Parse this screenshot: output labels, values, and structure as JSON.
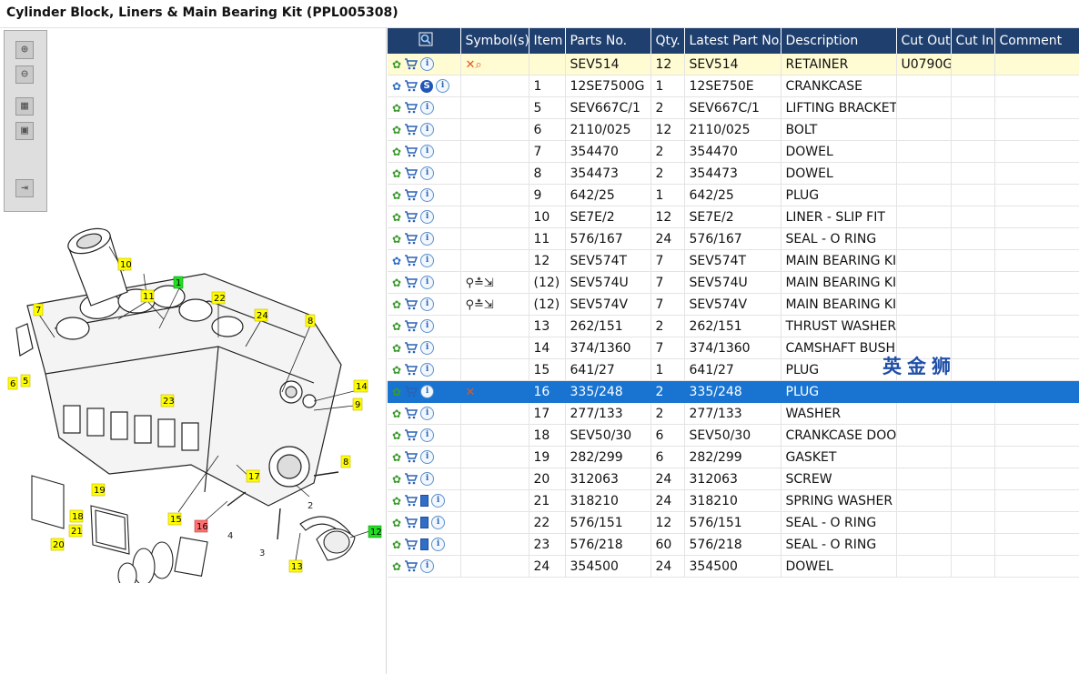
{
  "window": {
    "title": "Cylinder Block, Liners & Main Bearing Kit (PPL005308)"
  },
  "toolbar": {
    "buttons": [
      {
        "icon": "zoom-in-icon",
        "glyph": "⊕"
      },
      {
        "icon": "zoom-out-icon",
        "glyph": "⊖"
      },
      {
        "icon": "fit-page-icon",
        "glyph": "▦"
      },
      {
        "icon": "actual-size-icon",
        "glyph": "▣"
      },
      {
        "icon": "export-icon",
        "glyph": "⇥"
      }
    ]
  },
  "diagram": {
    "callouts": [
      {
        "label": "10",
        "style": "yellow"
      },
      {
        "label": "1",
        "style": "green"
      },
      {
        "label": "11",
        "style": "yellow"
      },
      {
        "label": "22",
        "style": "yellow"
      },
      {
        "label": "7",
        "style": "yellow"
      },
      {
        "label": "24",
        "style": "yellow"
      },
      {
        "label": "8",
        "style": "yellow"
      },
      {
        "label": "6",
        "style": "yellow"
      },
      {
        "label": "5",
        "style": "yellow"
      },
      {
        "label": "14",
        "style": "yellow"
      },
      {
        "label": "9",
        "style": "yellow"
      },
      {
        "label": "23",
        "style": "yellow"
      },
      {
        "label": "8",
        "style": "yellow"
      },
      {
        "label": "17",
        "style": "yellow"
      },
      {
        "label": "19",
        "style": "yellow"
      },
      {
        "label": "15",
        "style": "yellow"
      },
      {
        "label": "18",
        "style": "yellow"
      },
      {
        "label": "21",
        "style": "yellow"
      },
      {
        "label": "20",
        "style": "yellow"
      },
      {
        "label": "16",
        "style": "red"
      },
      {
        "label": "12",
        "style": "green"
      },
      {
        "label": "13",
        "style": "yellow"
      }
    ],
    "plain_labels": [
      "2",
      "3",
      "4"
    ]
  },
  "table": {
    "headers": [
      "",
      "Symbol(s)",
      "Item",
      "Parts No.",
      "Qty.",
      "Latest Part No.",
      "Description",
      "Cut Out",
      "Cut In",
      "Comment"
    ],
    "rows": [
      {
        "icons": [
          "gear",
          "cart",
          "info"
        ],
        "symbols": "✕⌕",
        "item": "",
        "part": "SEV514",
        "qty": "12",
        "latest": "SEV514",
        "desc": "RETAINER",
        "cut_out": "U0790G",
        "cut_in": "",
        "comment": "",
        "state": "highlight"
      },
      {
        "icons": [
          "gears",
          "cart",
          "s",
          "info"
        ],
        "symbols": "",
        "item": "1",
        "part": "12SE7500G",
        "qty": "1",
        "latest": "12SE750E",
        "desc": "CRANKCASE",
        "cut_out": "",
        "cut_in": "",
        "comment": "",
        "state": ""
      },
      {
        "icons": [
          "gear",
          "cart",
          "info"
        ],
        "symbols": "",
        "item": "5",
        "part": "SEV667C/1",
        "qty": "2",
        "latest": "SEV667C/1",
        "desc": "LIFTING BRACKET",
        "cut_out": "",
        "cut_in": "",
        "comment": "",
        "state": ""
      },
      {
        "icons": [
          "gear",
          "cart",
          "info"
        ],
        "symbols": "",
        "item": "6",
        "part": "2110/025",
        "qty": "12",
        "latest": "2110/025",
        "desc": "BOLT",
        "cut_out": "",
        "cut_in": "",
        "comment": "",
        "state": ""
      },
      {
        "icons": [
          "gear",
          "cart",
          "info"
        ],
        "symbols": "",
        "item": "7",
        "part": "354470",
        "qty": "2",
        "latest": "354470",
        "desc": "DOWEL",
        "cut_out": "",
        "cut_in": "",
        "comment": "",
        "state": ""
      },
      {
        "icons": [
          "gear",
          "cart",
          "info"
        ],
        "symbols": "",
        "item": "8",
        "part": "354473",
        "qty": "2",
        "latest": "354473",
        "desc": "DOWEL",
        "cut_out": "",
        "cut_in": "",
        "comment": "",
        "state": ""
      },
      {
        "icons": [
          "gear",
          "cart",
          "info"
        ],
        "symbols": "",
        "item": "9",
        "part": "642/25",
        "qty": "1",
        "latest": "642/25",
        "desc": "PLUG",
        "cut_out": "",
        "cut_in": "",
        "comment": "",
        "state": ""
      },
      {
        "icons": [
          "gear",
          "cart",
          "info"
        ],
        "symbols": "",
        "item": "10",
        "part": "SE7E/2",
        "qty": "12",
        "latest": "SE7E/2",
        "desc": "LINER - SLIP FIT",
        "cut_out": "",
        "cut_in": "",
        "comment": "",
        "state": ""
      },
      {
        "icons": [
          "gear",
          "cart",
          "info"
        ],
        "symbols": "",
        "item": "11",
        "part": "576/167",
        "qty": "24",
        "latest": "576/167",
        "desc": "SEAL - O RING",
        "cut_out": "",
        "cut_in": "",
        "comment": "",
        "state": ""
      },
      {
        "icons": [
          "gears",
          "cart",
          "info"
        ],
        "symbols": "",
        "item": "12",
        "part": "SEV574T",
        "qty": "7",
        "latest": "SEV574T",
        "desc": "MAIN BEARING KIT",
        "cut_out": "",
        "cut_in": "",
        "comment": "",
        "state": ""
      },
      {
        "icons": [
          "gear",
          "cart",
          "info"
        ],
        "symbols": "⚲≛⇲",
        "item": "(12)",
        "part": "SEV574U",
        "qty": "7",
        "latest": "SEV574U",
        "desc": "MAIN BEARING KIT",
        "cut_out": "",
        "cut_in": "",
        "comment": "",
        "state": ""
      },
      {
        "icons": [
          "gear",
          "cart",
          "info"
        ],
        "symbols": "⚲≛⇲",
        "item": "(12)",
        "part": "SEV574V",
        "qty": "7",
        "latest": "SEV574V",
        "desc": "MAIN BEARING KIT",
        "cut_out": "",
        "cut_in": "",
        "comment": "",
        "state": ""
      },
      {
        "icons": [
          "gear",
          "cart",
          "info"
        ],
        "symbols": "",
        "item": "13",
        "part": "262/151",
        "qty": "2",
        "latest": "262/151",
        "desc": "THRUST WASHER",
        "cut_out": "",
        "cut_in": "",
        "comment": "",
        "state": ""
      },
      {
        "icons": [
          "gear",
          "cart",
          "info"
        ],
        "symbols": "",
        "item": "14",
        "part": "374/1360",
        "qty": "7",
        "latest": "374/1360",
        "desc": "CAMSHAFT BUSH",
        "cut_out": "",
        "cut_in": "",
        "comment": "",
        "state": ""
      },
      {
        "icons": [
          "gear",
          "cart",
          "info"
        ],
        "symbols": "",
        "item": "15",
        "part": "641/27",
        "qty": "1",
        "latest": "641/27",
        "desc": "PLUG",
        "cut_out": "",
        "cut_in": "",
        "comment": "",
        "state": ""
      },
      {
        "icons": [
          "gear",
          "cart",
          "info"
        ],
        "symbols": "✕",
        "item": "16",
        "part": "335/248",
        "qty": "2",
        "latest": "335/248",
        "desc": "PLUG",
        "cut_out": "",
        "cut_in": "",
        "comment": "",
        "state": "selected"
      },
      {
        "icons": [
          "gear",
          "cart",
          "info"
        ],
        "symbols": "",
        "item": "17",
        "part": "277/133",
        "qty": "2",
        "latest": "277/133",
        "desc": "WASHER",
        "cut_out": "",
        "cut_in": "",
        "comment": "",
        "state": ""
      },
      {
        "icons": [
          "gear",
          "cart",
          "info"
        ],
        "symbols": "",
        "item": "18",
        "part": "SEV50/30",
        "qty": "6",
        "latest": "SEV50/30",
        "desc": "CRANKCASE DOOR",
        "cut_out": "",
        "cut_in": "",
        "comment": "",
        "state": ""
      },
      {
        "icons": [
          "gear",
          "cart",
          "info"
        ],
        "symbols": "",
        "item": "19",
        "part": "282/299",
        "qty": "6",
        "latest": "282/299",
        "desc": "GASKET",
        "cut_out": "",
        "cut_in": "",
        "comment": "",
        "state": ""
      },
      {
        "icons": [
          "gear",
          "cart",
          "info"
        ],
        "symbols": "",
        "item": "20",
        "part": "312063",
        "qty": "24",
        "latest": "312063",
        "desc": "SCREW",
        "cut_out": "",
        "cut_in": "",
        "comment": "",
        "state": ""
      },
      {
        "icons": [
          "gear",
          "cart",
          "book",
          "info"
        ],
        "symbols": "",
        "item": "21",
        "part": "318210",
        "qty": "24",
        "latest": "318210",
        "desc": "SPRING WASHER",
        "cut_out": "",
        "cut_in": "",
        "comment": "",
        "state": ""
      },
      {
        "icons": [
          "gear",
          "cart",
          "book",
          "info"
        ],
        "symbols": "",
        "item": "22",
        "part": "576/151",
        "qty": "12",
        "latest": "576/151",
        "desc": "SEAL - O RING",
        "cut_out": "",
        "cut_in": "",
        "comment": "",
        "state": ""
      },
      {
        "icons": [
          "gear",
          "cart",
          "book",
          "info"
        ],
        "symbols": "",
        "item": "23",
        "part": "576/218",
        "qty": "60",
        "latest": "576/218",
        "desc": "SEAL - O RING",
        "cut_out": "",
        "cut_in": "",
        "comment": "",
        "state": ""
      },
      {
        "icons": [
          "gear",
          "cart",
          "info"
        ],
        "symbols": "",
        "item": "24",
        "part": "354500",
        "qty": "24",
        "latest": "354500",
        "desc": "DOWEL",
        "cut_out": "",
        "cut_in": "",
        "comment": "",
        "state": ""
      }
    ]
  },
  "watermark": "英金狮",
  "colors": {
    "header_bg": "#1f3f6e",
    "selected_row": "#1874d0",
    "highlight_row": "#fffbd2",
    "callout_yellow": "#ffff00",
    "callout_green": "#22dd22",
    "callout_red": "#ff7070"
  }
}
